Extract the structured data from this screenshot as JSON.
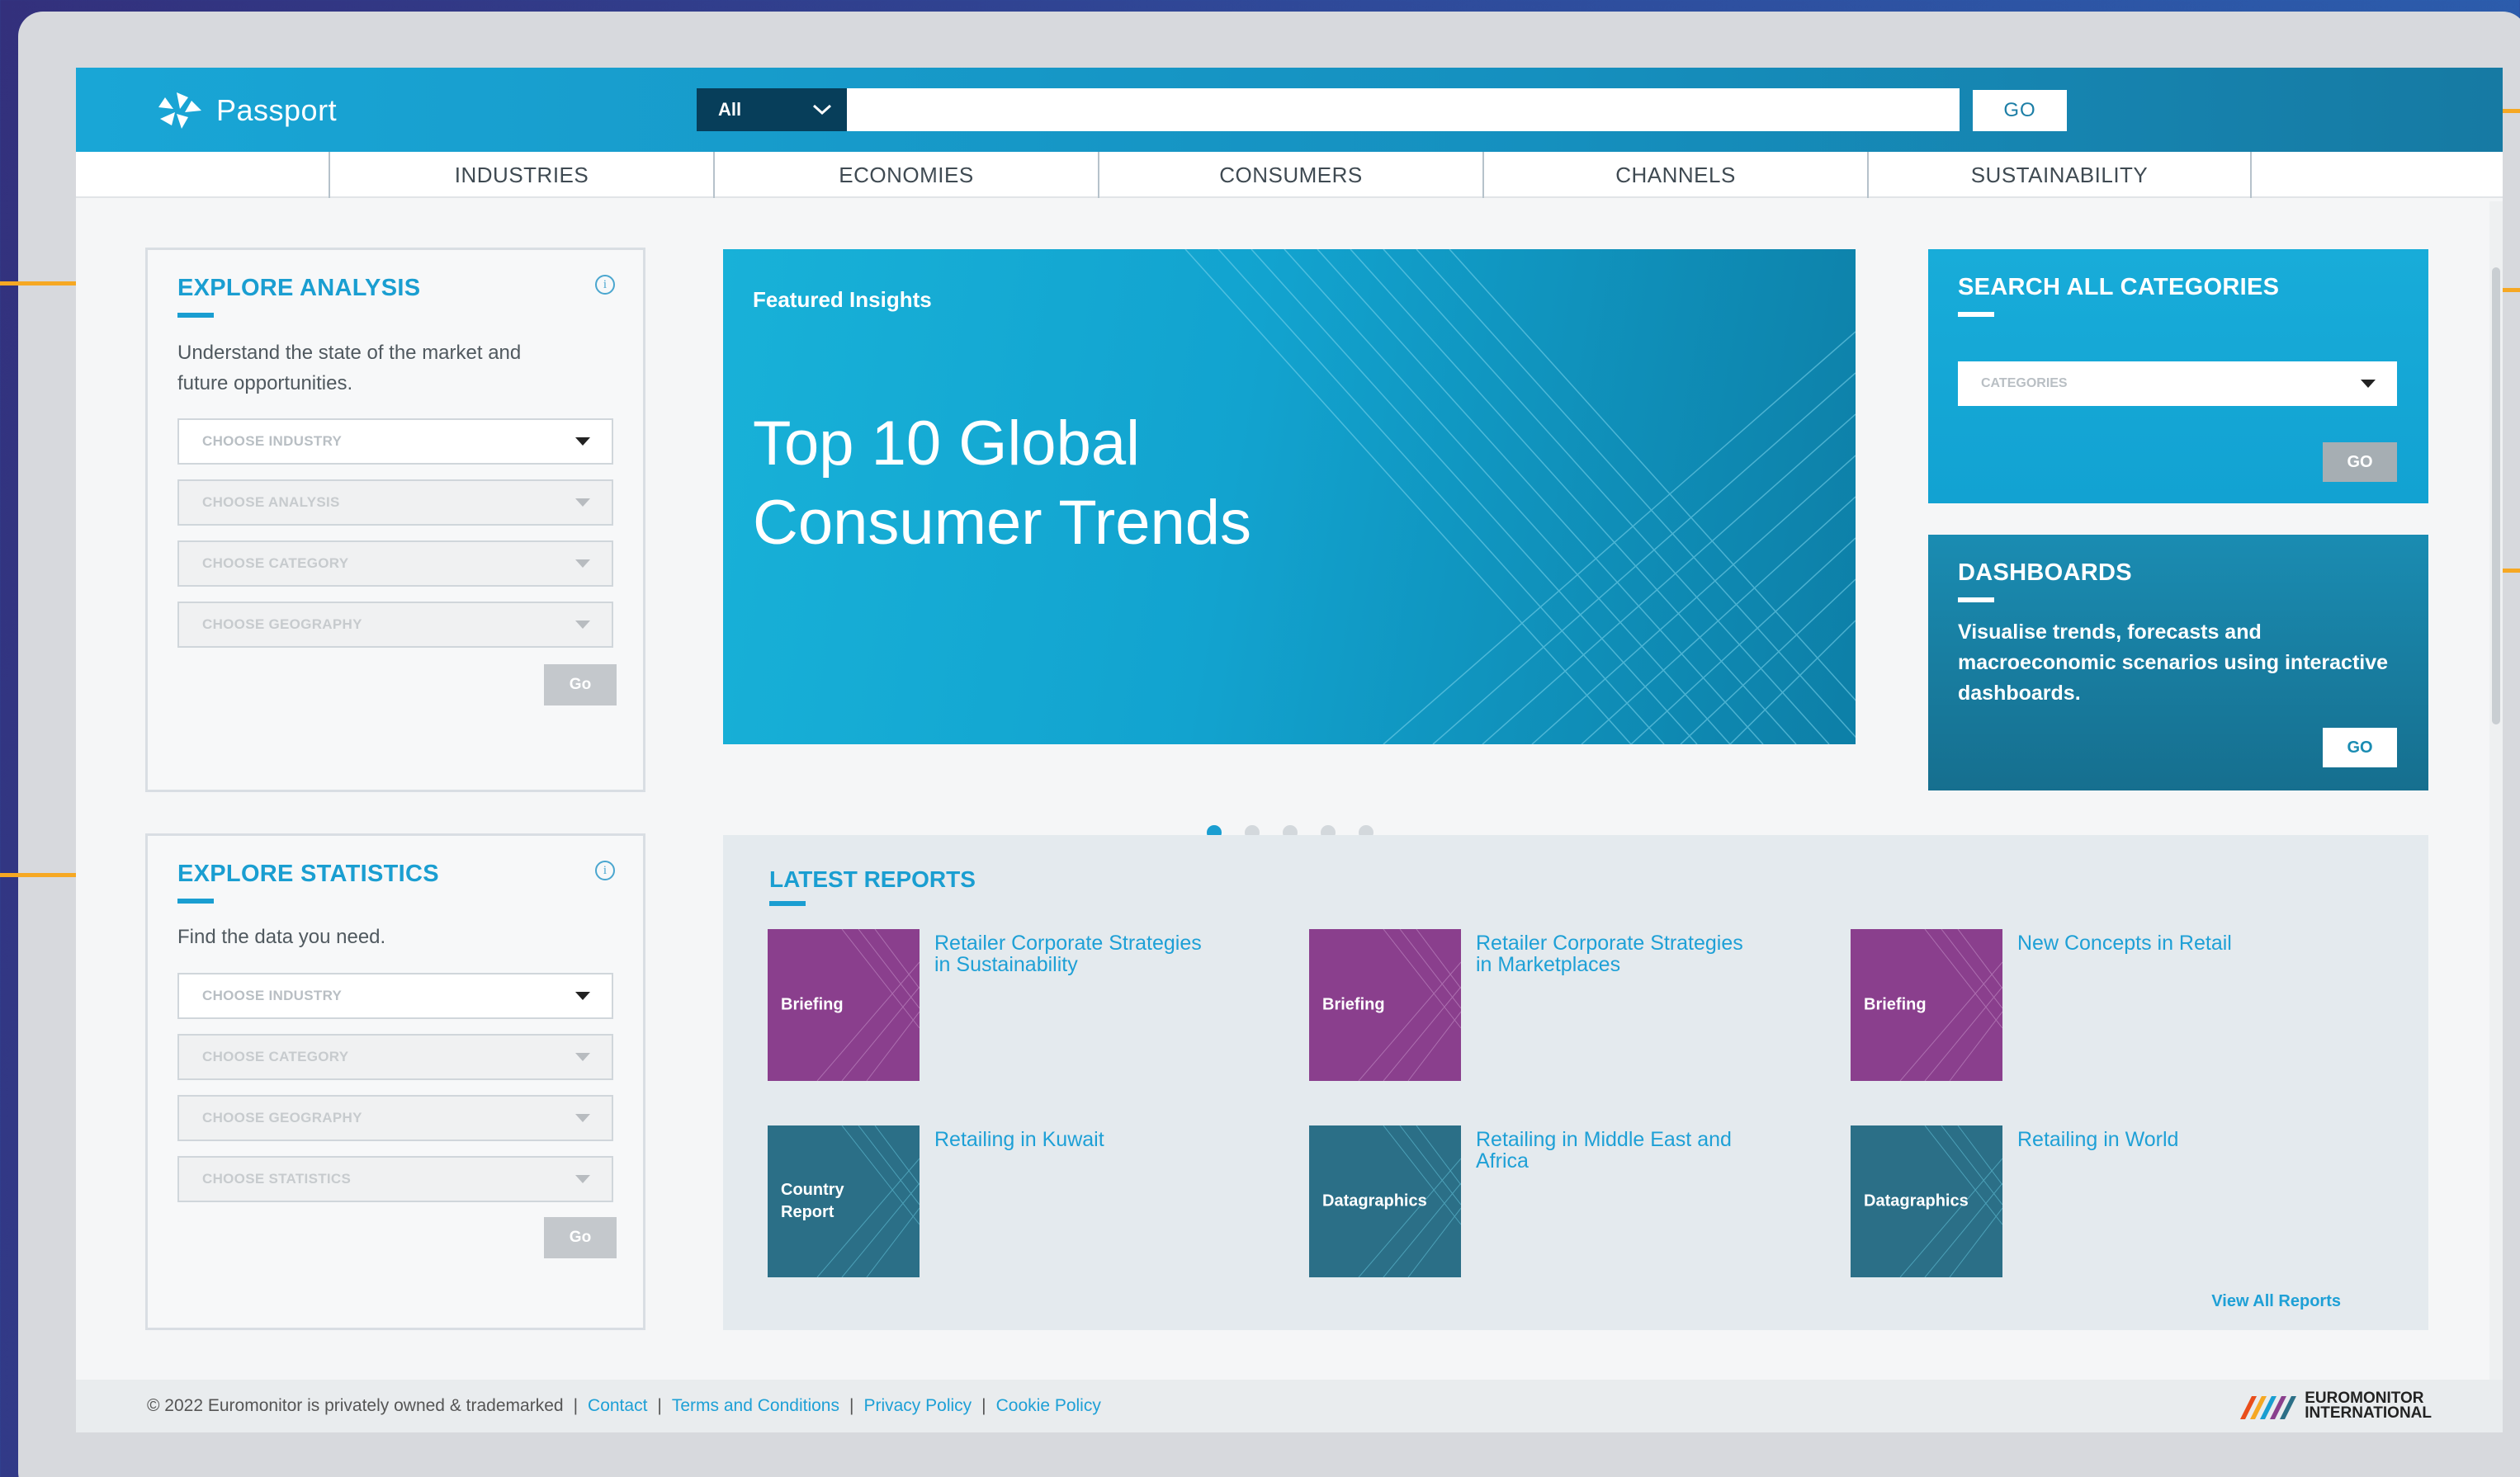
{
  "app": {
    "name": "Passport"
  },
  "search": {
    "scope": "All",
    "value": "",
    "go_label": "GO"
  },
  "nav": [
    "INDUSTRIES",
    "ECONOMIES",
    "CONSUMERS",
    "CHANNELS",
    "SUSTAINABILITY"
  ],
  "explore_analysis": {
    "title": "EXPLORE ANALYSIS",
    "info": "i",
    "desc_line1": "Understand the state of the market and",
    "desc_line2": "future opportunities.",
    "dropdowns": [
      "CHOOSE INDUSTRY",
      "CHOOSE ANALYSIS",
      "CHOOSE CATEGORY",
      "CHOOSE GEOGRAPHY"
    ],
    "go_label": "Go"
  },
  "explore_statistics": {
    "title": "EXPLORE STATISTICS",
    "info": "i",
    "desc": "Find the data you need.",
    "dropdowns": [
      "CHOOSE INDUSTRY",
      "CHOOSE CATEGORY",
      "CHOOSE GEOGRAPHY",
      "CHOOSE STATISTICS"
    ],
    "go_label": "Go"
  },
  "hero": {
    "label": "Featured Insights",
    "title_line1": "Top 10 Global",
    "title_line2": "Consumer Trends",
    "slides": 5,
    "active_slide": 1
  },
  "search_categories": {
    "title": "SEARCH ALL CATEGORIES",
    "placeholder": "CATEGORIES",
    "go_label": "GO"
  },
  "dashboards": {
    "title": "DASHBOARDS",
    "desc_line1": "Visualise trends, forecasts and",
    "desc_line2": "macroeconomic scenarios using interactive",
    "desc_line3": "dashboards.",
    "go_label": "GO"
  },
  "latest_reports": {
    "title": "LATEST REPORTS",
    "items": [
      {
        "type": "Briefing",
        "title_line1": "Retailer Corporate Strategies",
        "title_line2": "in Sustainability",
        "style": "purple"
      },
      {
        "type": "Briefing",
        "title_line1": "Retailer Corporate Strategies",
        "title_line2": "in Marketplaces",
        "style": "purple"
      },
      {
        "type": "Briefing",
        "title_line1": "New Concepts in Retail",
        "title_line2": "",
        "style": "purple"
      },
      {
        "type_line1": "Country",
        "type_line2": "Report",
        "title_line1": "Retailing in Kuwait",
        "title_line2": "",
        "style": "teal"
      },
      {
        "type": "Datagraphics",
        "title_line1": "Retailing in Middle East and",
        "title_line2": "Africa",
        "style": "teal"
      },
      {
        "type": "Datagraphics",
        "title_line1": "Retailing in World",
        "title_line2": "",
        "style": "teal"
      }
    ],
    "view_all": "View All Reports"
  },
  "footer": {
    "copyright": "© 2022 Euromonitor is privately owned & trademarked",
    "sep": "|",
    "links": [
      "Contact",
      "Terms and Conditions",
      "Privacy Policy",
      "Cookie Policy"
    ],
    "brand_line1": "EUROMONITOR",
    "brand_line2": "INTERNATIONAL"
  },
  "colors": {
    "primary": "#1a9ed1",
    "header": "#1590bf",
    "callout": "#f6a823",
    "briefing": "#8a3f8d",
    "datagraphics": "#2b6f87"
  }
}
